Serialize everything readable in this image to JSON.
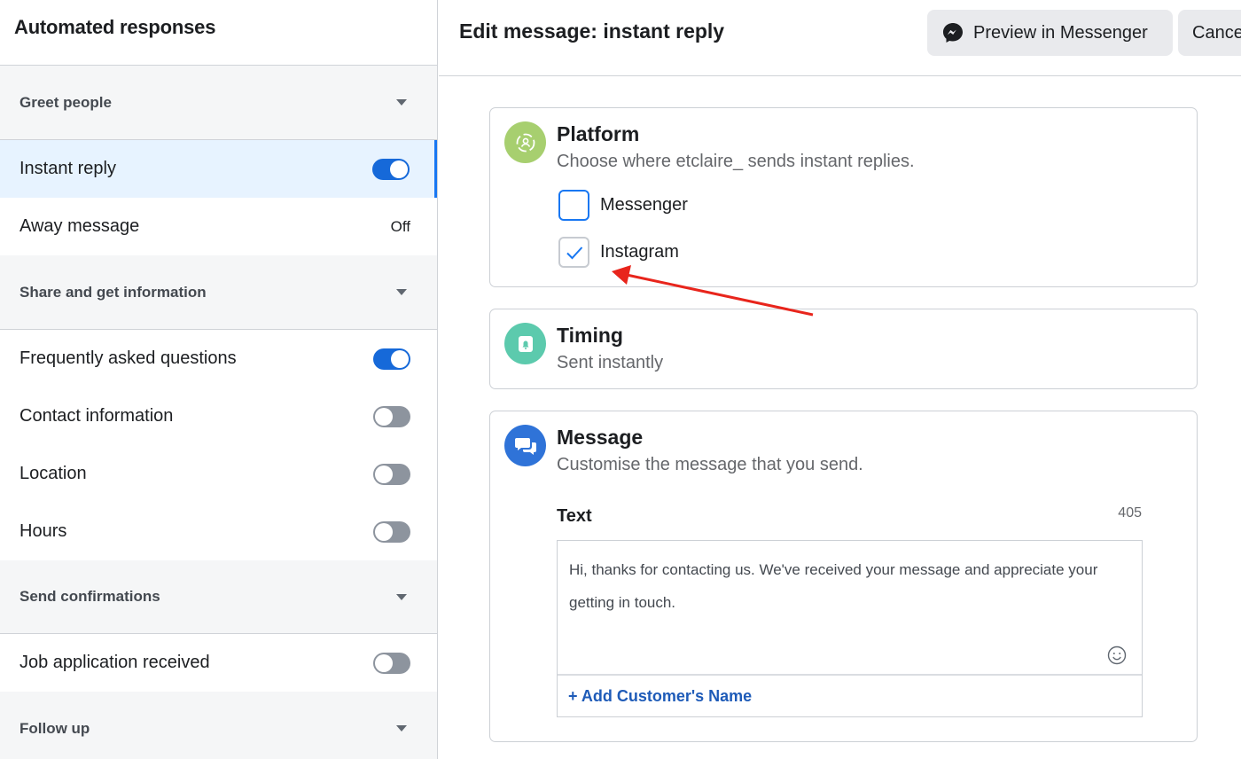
{
  "sidebar": {
    "title": "Automated responses",
    "sections": {
      "greet": {
        "label": "Greet people"
      },
      "share": {
        "label": "Share and get information"
      },
      "confirm": {
        "label": "Send confirmations"
      },
      "follow": {
        "label": "Follow up"
      }
    },
    "items": {
      "instant_reply": {
        "label": "Instant reply",
        "toggle": "on"
      },
      "away_message": {
        "label": "Away message",
        "status": "Off"
      },
      "faq": {
        "label": "Frequently asked questions",
        "toggle": "on"
      },
      "contact": {
        "label": "Contact information",
        "toggle": "off"
      },
      "location": {
        "label": "Location",
        "toggle": "off"
      },
      "hours": {
        "label": "Hours",
        "toggle": "off"
      },
      "job": {
        "label": "Job application received",
        "toggle": "off"
      }
    }
  },
  "header": {
    "title": "Edit message: instant reply",
    "preview_label": "Preview in Messenger",
    "cancel_label": "Cancel"
  },
  "platform": {
    "title": "Platform",
    "subtitle": "Choose where etclaire_ sends instant replies.",
    "options": [
      {
        "label": "Messenger",
        "checked": false
      },
      {
        "label": "Instagram",
        "checked": true
      }
    ]
  },
  "timing": {
    "title": "Timing",
    "subtitle": "Sent instantly"
  },
  "message": {
    "title": "Message",
    "subtitle": "Customise the message that you send.",
    "text_label": "Text",
    "char_count": "405",
    "text_value": "Hi, thanks for contacting us. We've received your message and appreciate your getting in touch.",
    "add_name_label": "+ Add Customer's Name"
  },
  "colors": {
    "accent": "#1877f2",
    "toggle_on": "#1669d9",
    "platform_icon": "#a7cf6f",
    "timing_icon": "#5ccaad",
    "message_icon": "#2f73d8",
    "annotation_arrow": "#e8251c"
  }
}
